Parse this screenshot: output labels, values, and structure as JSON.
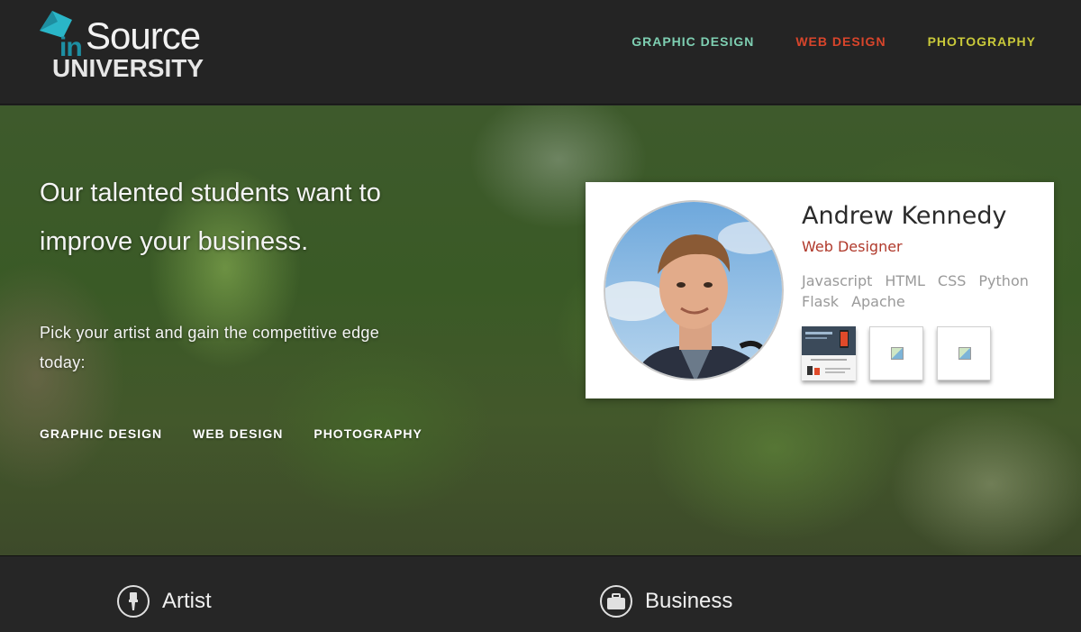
{
  "logo": {
    "in": "in",
    "source": "Source",
    "university": "UNIVERSITY",
    "mark_color": "#2ab6c8"
  },
  "nav": [
    {
      "label": "GRAPHIC DESIGN",
      "color": "#7ecfb2"
    },
    {
      "label": "WEB DESIGN",
      "color": "#d9452b"
    },
    {
      "label": "PHOTOGRAPHY",
      "color": "#c9c93a"
    }
  ],
  "hero": {
    "title": "Our talented students want to improve your business.",
    "subtitle": "Pick your artist and gain the competitive edge today:",
    "links": [
      "GRAPHIC DESIGN",
      "WEB DESIGN",
      "PHOTOGRAPHY"
    ]
  },
  "profile": {
    "name": "Andrew Kennedy",
    "role": "Web Designer",
    "skills": [
      "Javascript",
      "HTML",
      "CSS",
      "Python",
      "Flask",
      "Apache"
    ],
    "portfolio_thumbs": [
      "site-screenshot",
      "broken-image-icon",
      "broken-image-icon"
    ]
  },
  "band": {
    "artist": "Artist",
    "business": "Business",
    "icons": [
      "paintbrush-icon",
      "briefcase-icon"
    ]
  },
  "colors": {
    "header_bg": "#242424",
    "accent_red": "#b0392b",
    "teal": "#2ab6c8"
  }
}
